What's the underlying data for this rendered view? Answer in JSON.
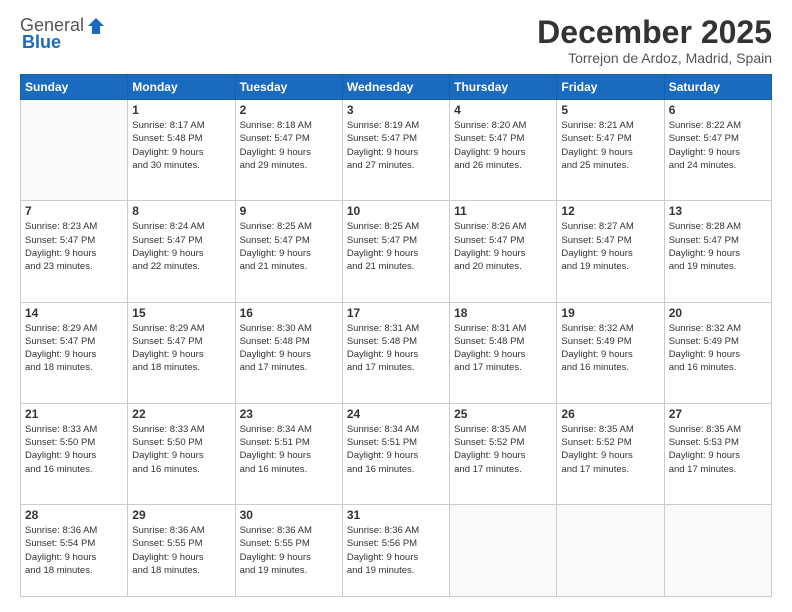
{
  "logo": {
    "general": "General",
    "blue": "Blue"
  },
  "title": "December 2025",
  "subtitle": "Torrejon de Ardoz, Madrid, Spain",
  "weekdays": [
    "Sunday",
    "Monday",
    "Tuesday",
    "Wednesday",
    "Thursday",
    "Friday",
    "Saturday"
  ],
  "weeks": [
    [
      {
        "day": "",
        "info": ""
      },
      {
        "day": "1",
        "info": "Sunrise: 8:17 AM\nSunset: 5:48 PM\nDaylight: 9 hours\nand 30 minutes."
      },
      {
        "day": "2",
        "info": "Sunrise: 8:18 AM\nSunset: 5:47 PM\nDaylight: 9 hours\nand 29 minutes."
      },
      {
        "day": "3",
        "info": "Sunrise: 8:19 AM\nSunset: 5:47 PM\nDaylight: 9 hours\nand 27 minutes."
      },
      {
        "day": "4",
        "info": "Sunrise: 8:20 AM\nSunset: 5:47 PM\nDaylight: 9 hours\nand 26 minutes."
      },
      {
        "day": "5",
        "info": "Sunrise: 8:21 AM\nSunset: 5:47 PM\nDaylight: 9 hours\nand 25 minutes."
      },
      {
        "day": "6",
        "info": "Sunrise: 8:22 AM\nSunset: 5:47 PM\nDaylight: 9 hours\nand 24 minutes."
      }
    ],
    [
      {
        "day": "7",
        "info": "Sunrise: 8:23 AM\nSunset: 5:47 PM\nDaylight: 9 hours\nand 23 minutes."
      },
      {
        "day": "8",
        "info": "Sunrise: 8:24 AM\nSunset: 5:47 PM\nDaylight: 9 hours\nand 22 minutes."
      },
      {
        "day": "9",
        "info": "Sunrise: 8:25 AM\nSunset: 5:47 PM\nDaylight: 9 hours\nand 21 minutes."
      },
      {
        "day": "10",
        "info": "Sunrise: 8:25 AM\nSunset: 5:47 PM\nDaylight: 9 hours\nand 21 minutes."
      },
      {
        "day": "11",
        "info": "Sunrise: 8:26 AM\nSunset: 5:47 PM\nDaylight: 9 hours\nand 20 minutes."
      },
      {
        "day": "12",
        "info": "Sunrise: 8:27 AM\nSunset: 5:47 PM\nDaylight: 9 hours\nand 19 minutes."
      },
      {
        "day": "13",
        "info": "Sunrise: 8:28 AM\nSunset: 5:47 PM\nDaylight: 9 hours\nand 19 minutes."
      }
    ],
    [
      {
        "day": "14",
        "info": "Sunrise: 8:29 AM\nSunset: 5:47 PM\nDaylight: 9 hours\nand 18 minutes."
      },
      {
        "day": "15",
        "info": "Sunrise: 8:29 AM\nSunset: 5:47 PM\nDaylight: 9 hours\nand 18 minutes."
      },
      {
        "day": "16",
        "info": "Sunrise: 8:30 AM\nSunset: 5:48 PM\nDaylight: 9 hours\nand 17 minutes."
      },
      {
        "day": "17",
        "info": "Sunrise: 8:31 AM\nSunset: 5:48 PM\nDaylight: 9 hours\nand 17 minutes."
      },
      {
        "day": "18",
        "info": "Sunrise: 8:31 AM\nSunset: 5:48 PM\nDaylight: 9 hours\nand 17 minutes."
      },
      {
        "day": "19",
        "info": "Sunrise: 8:32 AM\nSunset: 5:49 PM\nDaylight: 9 hours\nand 16 minutes."
      },
      {
        "day": "20",
        "info": "Sunrise: 8:32 AM\nSunset: 5:49 PM\nDaylight: 9 hours\nand 16 minutes."
      }
    ],
    [
      {
        "day": "21",
        "info": "Sunrise: 8:33 AM\nSunset: 5:50 PM\nDaylight: 9 hours\nand 16 minutes."
      },
      {
        "day": "22",
        "info": "Sunrise: 8:33 AM\nSunset: 5:50 PM\nDaylight: 9 hours\nand 16 minutes."
      },
      {
        "day": "23",
        "info": "Sunrise: 8:34 AM\nSunset: 5:51 PM\nDaylight: 9 hours\nand 16 minutes."
      },
      {
        "day": "24",
        "info": "Sunrise: 8:34 AM\nSunset: 5:51 PM\nDaylight: 9 hours\nand 16 minutes."
      },
      {
        "day": "25",
        "info": "Sunrise: 8:35 AM\nSunset: 5:52 PM\nDaylight: 9 hours\nand 17 minutes."
      },
      {
        "day": "26",
        "info": "Sunrise: 8:35 AM\nSunset: 5:52 PM\nDaylight: 9 hours\nand 17 minutes."
      },
      {
        "day": "27",
        "info": "Sunrise: 8:35 AM\nSunset: 5:53 PM\nDaylight: 9 hours\nand 17 minutes."
      }
    ],
    [
      {
        "day": "28",
        "info": "Sunrise: 8:36 AM\nSunset: 5:54 PM\nDaylight: 9 hours\nand 18 minutes."
      },
      {
        "day": "29",
        "info": "Sunrise: 8:36 AM\nSunset: 5:55 PM\nDaylight: 9 hours\nand 18 minutes."
      },
      {
        "day": "30",
        "info": "Sunrise: 8:36 AM\nSunset: 5:55 PM\nDaylight: 9 hours\nand 19 minutes."
      },
      {
        "day": "31",
        "info": "Sunrise: 8:36 AM\nSunset: 5:56 PM\nDaylight: 9 hours\nand 19 minutes."
      },
      {
        "day": "",
        "info": ""
      },
      {
        "day": "",
        "info": ""
      },
      {
        "day": "",
        "info": ""
      }
    ]
  ]
}
